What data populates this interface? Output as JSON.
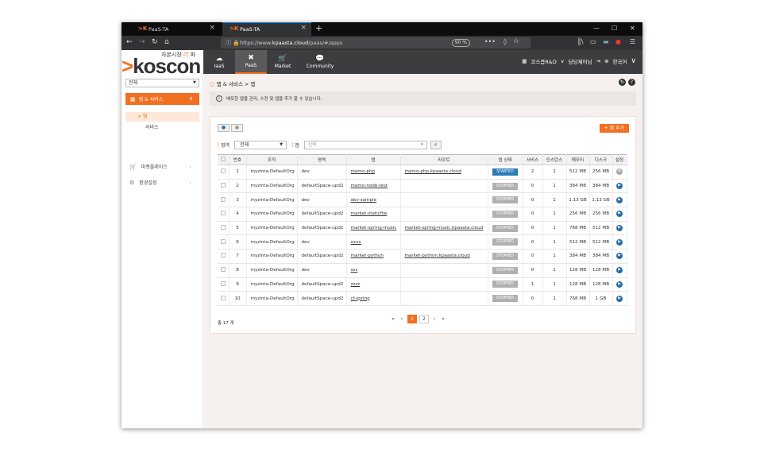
{
  "browser": {
    "tabs": [
      {
        "title": "PaaS-TA",
        "logo": ">K"
      },
      {
        "title": "PaaS-TA",
        "logo": ">K"
      }
    ],
    "url_prefix": "https://www.",
    "url_host": "kpaasta.cloud",
    "url_path": "/paas/#/apps",
    "zoom": "90 %"
  },
  "header": {
    "logo_sub_before": "자본시장 ",
    "logo_sub_accent": "IT",
    "logo_sub_after": " 파",
    "logo_text": "koscon",
    "nav": [
      {
        "label": "IaaS",
        "icon": "cloud-icon"
      },
      {
        "label": "PaaS",
        "icon": "tools-icon"
      },
      {
        "label": "Market",
        "icon": "cart-icon"
      },
      {
        "label": "Community",
        "icon": "chat-icon"
      }
    ],
    "org_label": "코스콤R&D",
    "user_label": "담당제어님",
    "lang_label": "한국어"
  },
  "sidebar": {
    "select_value": "전체",
    "active_menu": "앱 & 서비스",
    "sub_active": "> 앱",
    "sub_item": "서비스",
    "items": [
      {
        "label": "마켓플레이스"
      },
      {
        "label": "환경설정"
      }
    ]
  },
  "main": {
    "breadcrumb": "앱 & 서비스 > 앱",
    "info": "배포한 앱을 관리, 수정 및 앱을 추가 할 수 있습니다.",
    "add_button": "+ 앱 추가",
    "filter": {
      "region_label": "영역",
      "region_value": "전체",
      "app_label": "앱",
      "app_placeholder": "선택"
    },
    "columns": [
      "",
      "번호",
      "조직",
      "영역",
      "앱",
      "라우트",
      "앱 상태",
      "서비스",
      "인스턴스",
      "메모리",
      "디스크",
      "설정"
    ],
    "rows": [
      {
        "no": "1",
        "org": "myzinta-DefaultOrg",
        "space": "dev",
        "app": "memo-php",
        "route": "memo-php.kpaasta.cloud",
        "status": "STARTED",
        "services": "2",
        "instances": "1",
        "memory": "512 MB",
        "disk": "256 MB"
      },
      {
        "no": "2",
        "org": "myzinta-DefaultOrg",
        "space": "defaultSpace-upd2",
        "app": "memo-node-test",
        "route": "",
        "status": "STOPPED",
        "services": "0",
        "instances": "1",
        "memory": "384 MB",
        "disk": "384 MB"
      },
      {
        "no": "3",
        "org": "myzinta-DefaultOrg",
        "space": "dev",
        "app": "dev-sample",
        "route": "",
        "status": "STOPPED",
        "services": "0",
        "instances": "1",
        "memory": "1.13 GB",
        "disk": "1.13 GB"
      },
      {
        "no": "4",
        "org": "myzinta-DefaultOrg",
        "space": "defaultSpace-upd2",
        "app": "market-staticfile",
        "route": "",
        "status": "STOPPED",
        "services": "0",
        "instances": "1",
        "memory": "256 MB",
        "disk": "256 MB"
      },
      {
        "no": "5",
        "org": "myzinta-DefaultOrg",
        "space": "defaultSpace-upd2",
        "app": "market-spring-music",
        "route": "market-spring-music.kpaasta.cloud",
        "status": "STOPPED",
        "services": "0",
        "instances": "1",
        "memory": "768 MB",
        "disk": "512 MB"
      },
      {
        "no": "6",
        "org": "myzinta-DefaultOrg",
        "space": "dev",
        "app": "xxxx",
        "route": "",
        "status": "STOPPED",
        "services": "0",
        "instances": "1",
        "memory": "512 MB",
        "disk": "512 MB"
      },
      {
        "no": "7",
        "org": "myzinta-DefaultOrg",
        "space": "defaultSpace-upd2",
        "app": "market-python",
        "route": "market-python.kpaasta.cloud",
        "status": "STOPPED",
        "services": "0",
        "instances": "1",
        "memory": "384 MB",
        "disk": "384 MB"
      },
      {
        "no": "8",
        "org": "myzinta-DefaultOrg",
        "space": "dev",
        "app": "sss",
        "route": "",
        "status": "STOPPED",
        "services": "0",
        "instances": "1",
        "memory": "128 MB",
        "disk": "128 MB"
      },
      {
        "no": "9",
        "org": "myzinta-DefaultOrg",
        "space": "defaultSpace-upd2",
        "app": "zzzz",
        "route": "",
        "status": "STOPPED",
        "services": "1",
        "instances": "1",
        "memory": "128 MB",
        "disk": "128 MB"
      },
      {
        "no": "10",
        "org": "myzinta-DefaultOrg",
        "space": "defaultSpace-upd2",
        "app": "cf-spring",
        "route": "",
        "status": "STOPPED",
        "services": "0",
        "instances": "1",
        "memory": "768 MB",
        "disk": "1 GB"
      }
    ],
    "total": "총 17 개",
    "pages": [
      "1",
      "2"
    ],
    "current_page": "1"
  },
  "colors": {
    "accent": "#f36f21",
    "started": "#2c7bb6",
    "stopped": "#b0b0b0",
    "play": "#2c6fa8"
  }
}
